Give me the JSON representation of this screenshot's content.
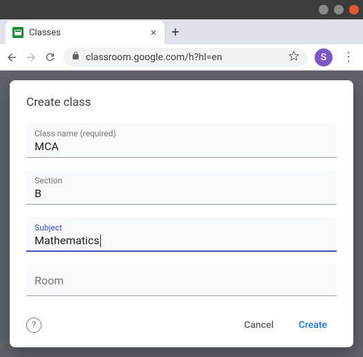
{
  "window": {
    "tab_title": "Classes",
    "favicon_letter": "▭",
    "url": "classroom.google.com/h?hl=en",
    "avatar_letter": "S"
  },
  "modal": {
    "title": "Create class",
    "fields": {
      "class_name": {
        "label": "Class name (required)",
        "value": "MCA"
      },
      "section": {
        "label": "Section",
        "value": "B"
      },
      "subject": {
        "label": "Subject",
        "value": "Mathematics"
      },
      "room": {
        "label": "Room",
        "value": ""
      }
    },
    "buttons": {
      "cancel": "Cancel",
      "create": "Create"
    },
    "help": "?"
  }
}
